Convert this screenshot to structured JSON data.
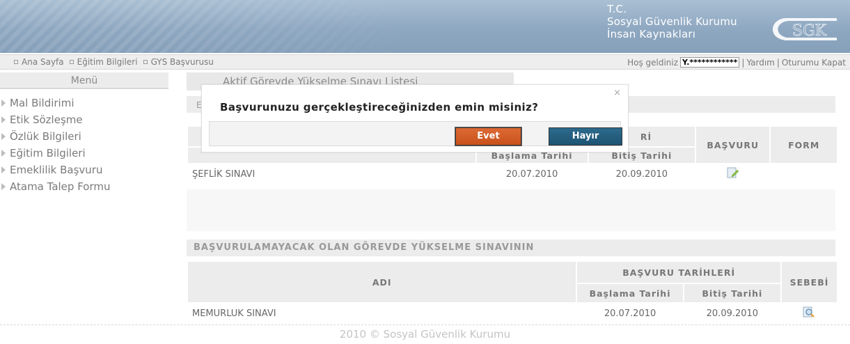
{
  "header": {
    "org_line1": "T.C.",
    "org_line2": "Sosyal Güvenlik Kurumu",
    "org_line3": "İnsan Kaynakları",
    "logo_text": "SGK"
  },
  "nav": {
    "breadcrumbs": [
      "Ana Sayfa",
      "Eğitim Bilgileri",
      "GYS Başvurusu"
    ],
    "welcome": "Hoş geldiniz",
    "username": "Y.************",
    "help": "Yardım",
    "logout": "Oturumu Kapat",
    "separator": "|"
  },
  "sidebar": {
    "title": "Menü",
    "items": [
      {
        "label": "Mal Bildirimi"
      },
      {
        "label": "Etik Sözleşme"
      },
      {
        "label": "Özlük Bilgileri"
      },
      {
        "label": "Eğitim Bilgileri"
      },
      {
        "label": "Emeklilik Başvuru"
      },
      {
        "label": "Atama Talep Formu"
      }
    ]
  },
  "main": {
    "tab_title": "Aktif Görevde Yükselme Sınavı Listesi",
    "section1_stub": "E",
    "table1": {
      "group_header_fragment": "Rİ",
      "col_start": "Başlama Tarihi",
      "col_end": "Bitiş Tarihi",
      "col_apply": "BAŞVURU",
      "col_form": "FORM",
      "rows": [
        {
          "name": "ŞEFLİK SINAVI",
          "start": "20.07.2010",
          "end": "20.09.2010"
        }
      ]
    },
    "section2_title": "BAŞVURULAMAYACAK OLAN GÖREVDE YÜKSELME SINAVININ",
    "table2": {
      "col_name": "ADI",
      "group_header": "BAŞVURU TARİHLERİ",
      "col_start": "Başlama Tarihi",
      "col_end": "Bitiş Tarihi",
      "col_reason": "SEBEBİ",
      "rows": [
        {
          "name": "MEMURLUK SINAVI",
          "start": "20.07.2010",
          "end": "20.09.2010"
        }
      ]
    }
  },
  "footer": {
    "text": "2010 © Sosyal Güvenlik Kurumu"
  },
  "dialog": {
    "message": "Başvurunuzu gerçekleştireceğinizden emin misiniz?",
    "close": "×",
    "yes_label": "Evet",
    "no_label": "Hayır"
  },
  "colors": {
    "banner": "#8fa8c1",
    "yes_button": "#d45f28",
    "no_button": "#24607f"
  }
}
